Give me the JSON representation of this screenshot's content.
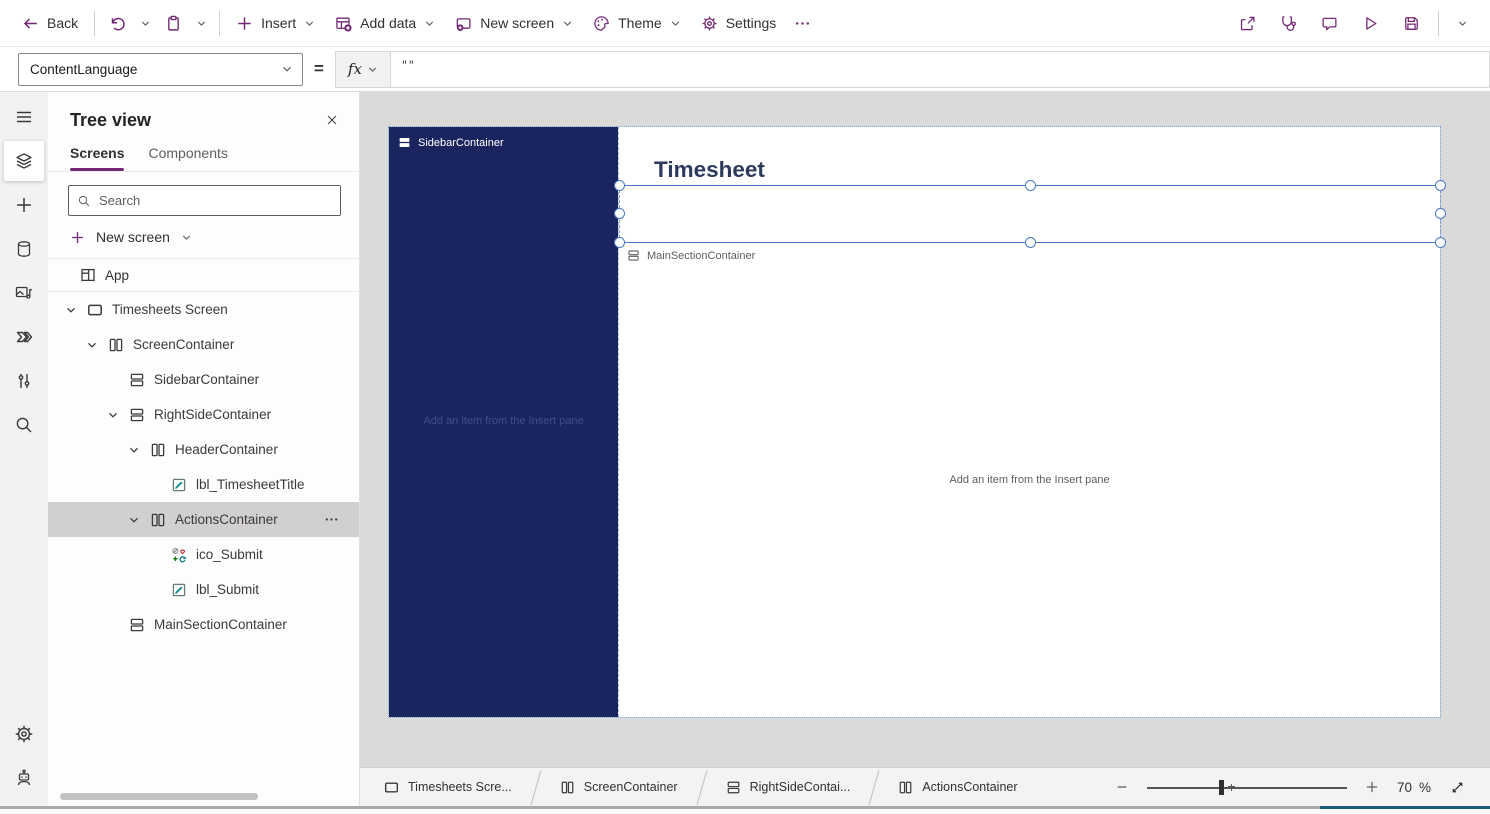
{
  "command_bar": {
    "left": [
      {
        "type": "button",
        "name": "back-button",
        "icon": "back-arrow",
        "label": "Back"
      },
      {
        "type": "divider"
      },
      {
        "type": "icon-button",
        "name": "undo-button",
        "icon": "undo"
      },
      {
        "type": "chevron-button",
        "name": "undo-menu-button"
      },
      {
        "type": "icon-button",
        "name": "paste-button",
        "icon": "paste"
      },
      {
        "type": "chevron-button",
        "name": "paste-menu-button"
      },
      {
        "type": "divider"
      },
      {
        "type": "button",
        "name": "insert-button",
        "icon": "plus",
        "label": "Insert",
        "chevron": true
      },
      {
        "type": "button",
        "name": "add-data-button",
        "icon": "add-data",
        "label": "Add data",
        "chevron": true
      },
      {
        "type": "button",
        "name": "new-screen-button",
        "icon": "new-screen",
        "label": "New screen",
        "chevron": true
      },
      {
        "type": "button",
        "name": "theme-button",
        "icon": "theme",
        "label": "Theme",
        "chevron": true
      },
      {
        "type": "button",
        "name": "settings-button",
        "icon": "settings-gear",
        "label": "Settings"
      },
      {
        "type": "icon-button",
        "name": "more-commands-button",
        "icon": "more"
      }
    ],
    "right": [
      {
        "type": "icon-button",
        "name": "share-button",
        "icon": "share"
      },
      {
        "type": "icon-button",
        "name": "app-checker-button",
        "icon": "stethoscope"
      },
      {
        "type": "icon-button",
        "name": "comments-button",
        "icon": "comment"
      },
      {
        "type": "icon-button",
        "name": "preview-app-button",
        "icon": "play"
      },
      {
        "type": "icon-button",
        "name": "save-button",
        "icon": "save"
      },
      {
        "type": "divider"
      },
      {
        "type": "chevron-button",
        "name": "save-menu-button"
      }
    ]
  },
  "formula_bar": {
    "property_selector": "ContentLanguage",
    "equals_sign": "=",
    "fx_label": "fx",
    "formula_value": "\"\""
  },
  "left_rail": {
    "top": [
      {
        "name": "menu",
        "icon": "hamburger"
      },
      {
        "name": "tree-view",
        "icon": "layers",
        "selected": true
      },
      {
        "name": "insert",
        "icon": "plus-large"
      },
      {
        "name": "data",
        "icon": "database"
      },
      {
        "name": "media",
        "icon": "media"
      },
      {
        "name": "power-automate",
        "icon": "flow"
      },
      {
        "name": "variables",
        "icon": "variables"
      },
      {
        "name": "search",
        "icon": "magnifier"
      }
    ],
    "bottom": [
      {
        "name": "advanced-settings",
        "icon": "settings-gear"
      },
      {
        "name": "virtual-agent",
        "icon": "robot"
      }
    ]
  },
  "tree_panel": {
    "title": "Tree view",
    "tabs": [
      {
        "label": "Screens",
        "active": true
      },
      {
        "label": "Components",
        "active": false
      }
    ],
    "search_placeholder": "Search",
    "new_screen_label": "New screen",
    "app_label": "App",
    "items": [
      {
        "label": "Timesheets Screen",
        "icon": "screen",
        "depth": 0,
        "expanded": true
      },
      {
        "label": "ScreenContainer",
        "icon": "container-h",
        "depth": 1,
        "expanded": true
      },
      {
        "label": "SidebarContainer",
        "icon": "container-v",
        "depth": 2
      },
      {
        "label": "RightSideContainer",
        "icon": "container-v",
        "depth": 2,
        "expanded": true
      },
      {
        "label": "HeaderContainer",
        "icon": "container-h",
        "depth": 3,
        "expanded": true
      },
      {
        "label": "lbl_TimesheetTitle",
        "icon": "label",
        "depth": 4
      },
      {
        "label": "ActionsContainer",
        "icon": "container-h",
        "depth": 3,
        "expanded": true,
        "selected": true,
        "more": true
      },
      {
        "label": "ico_Submit",
        "icon": "icon-multi",
        "depth": 4
      },
      {
        "label": "lbl_Submit",
        "icon": "label",
        "depth": 4
      },
      {
        "label": "MainSectionContainer",
        "icon": "container-v",
        "depth": 2
      }
    ]
  },
  "canvas": {
    "sidebar_container_label": "SidebarContainer",
    "sidebar_hint": "Add an item from the Insert pane",
    "timesheet_title": "Timesheet",
    "main_section_label": "MainSectionContainer",
    "main_hint": "Add an item from the Insert pane"
  },
  "status_bar": {
    "breadcrumbs": [
      {
        "label": "Timesheets Scre...",
        "icon": "screen"
      },
      {
        "label": "ScreenContainer",
        "icon": "container-h"
      },
      {
        "label": "RightSideContai...",
        "icon": "container-v"
      },
      {
        "label": "ActionsContainer",
        "icon": "container-h"
      }
    ],
    "zoom_value": "70",
    "zoom_percent": "%"
  },
  "colors": {
    "accent_purple": "#742774",
    "sidebar_navy": "#1a2560",
    "selection_blue": "#4a79c4",
    "title_navy": "#2c3b5c"
  }
}
